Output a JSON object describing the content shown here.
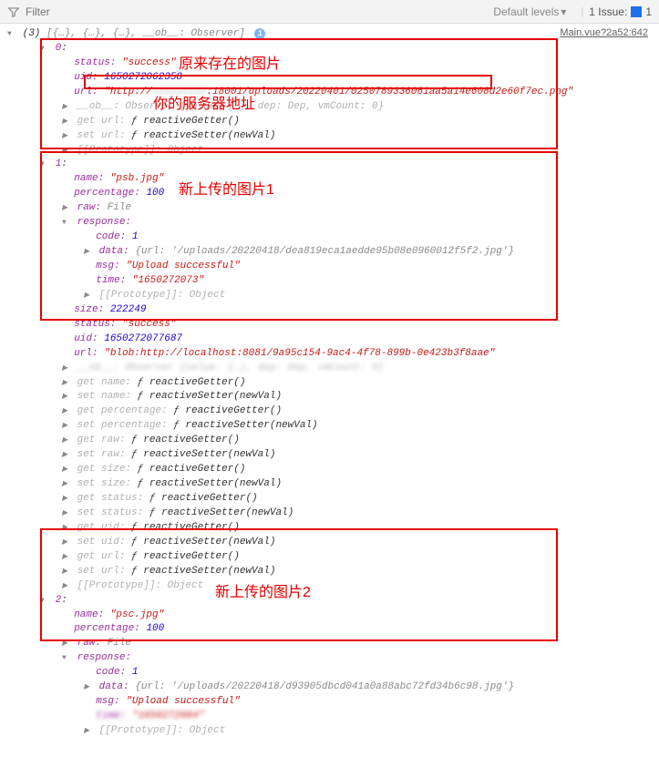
{
  "toolbar": {
    "filter_placeholder": "Filter",
    "levels_label": "Default levels",
    "issue_label": "1 Issue:",
    "issue_count": "1"
  },
  "source_link": "Main.vue?2a52:642",
  "header": {
    "count": "(3)",
    "preview": "[{…}, {…}, {…}, __ob__: Observer]"
  },
  "item0": {
    "index": "0",
    "status_key": "status:",
    "status_val": "\"success\"",
    "uid_key": "uid:",
    "uid_val": "1650272062358",
    "url_key": "url:",
    "url_prefix": "\"http://",
    "url_mid": ":18001/",
    "url_path": "uploads/20220401/0250789336061aa5a14e608d2e60f7ec.png\"",
    "ob_line": "__ob__: Observer {value: {…}, dep: Dep, vmCount: 0}",
    "get_url": "get url: ",
    "get_url_fn": "ƒ reactiveGetter()",
    "set_url": "set url: ",
    "set_url_fn": "ƒ reactiveSetter(newVal)",
    "proto": "[[Prototype]]: Object"
  },
  "item1": {
    "index": "1",
    "name_key": "name:",
    "name_val": "\"psb.jpg\"",
    "pct_key": "percentage:",
    "pct_val": "100",
    "raw_key": "raw:",
    "raw_val": "File",
    "resp_key": "response:",
    "code_key": "code:",
    "code_val": "1",
    "data_key": "data:",
    "data_val": "{url: '/uploads/20220418/dea819eca1aedde95b08e0960012f5f2.jpg'}",
    "msg_key": "msg:",
    "msg_val": "\"Upload successful\"",
    "time_key": "time:",
    "time_val": "\"1650272073\"",
    "proto_inner": "[[Prototype]]: Object",
    "size_key": "size:",
    "size_val": "222249",
    "status_key": "status:",
    "status_val": "\"success\"",
    "uid_key": "uid:",
    "uid_val": "1650272077687",
    "url_key": "url:",
    "url_val": "\"blob:http://localhost:8081/9a95c154-9ac4-4f78-899b-0e423b3f8aae\"",
    "ob_line": "__ob__: Observer {value: {…}, dep: Dep, vmCount: 0}",
    "getters": [
      "get name: ƒ reactiveGetter()",
      "set name: ƒ reactiveSetter(newVal)",
      "get percentage: ƒ reactiveGetter()",
      "set percentage: ƒ reactiveSetter(newVal)",
      "get raw: ƒ reactiveGetter()",
      "set raw: ƒ reactiveSetter(newVal)",
      "get size: ƒ reactiveGetter()",
      "set size: ƒ reactiveSetter(newVal)",
      "get status: ƒ reactiveGetter()",
      "set status: ƒ reactiveSetter(newVal)",
      "get uid: ƒ reactiveGetter()",
      "set uid: ƒ reactiveSetter(newVal)",
      "get url: ƒ reactiveGetter()",
      "set url: ƒ reactiveSetter(newVal)"
    ],
    "proto": "[[Prototype]]: Object"
  },
  "item2": {
    "index": "2",
    "name_key": "name:",
    "name_val": "\"psc.jpg\"",
    "pct_key": "percentage:",
    "pct_val": "100",
    "raw_key": "raw:",
    "raw_val": "File",
    "resp_key": "response:",
    "code_key": "code:",
    "code_val": "1",
    "data_key": "data:",
    "data_val": "{url: '/uploads/20220418/d93905dbcd041a0a88abc72fd34b6c98.jpg'}",
    "msg_key": "msg:",
    "msg_val": "\"Upload successful\"",
    "time_key": "time:",
    "time_val": "\"1650272084\"",
    "proto": "[[Prototype]]: Object"
  },
  "annotations": {
    "a1": "原来存在的图片",
    "a2": "你的服务器地址",
    "a3": "新上传的图片1",
    "a4": "新上传的图片2"
  }
}
